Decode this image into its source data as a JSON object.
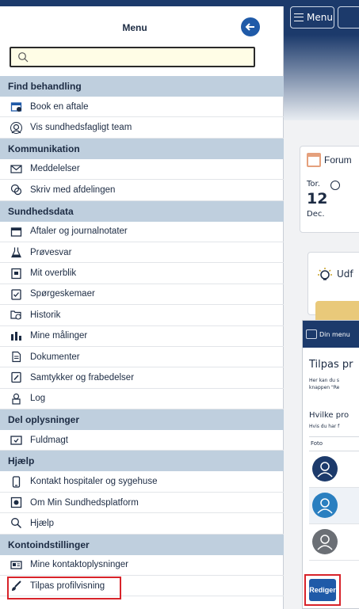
{
  "background_app": {
    "menu_button_label": "Menu",
    "card_title": "Forum",
    "date_day": "Tor.",
    "date_num": "12",
    "date_month": "Dec.",
    "card2_title": "Udf"
  },
  "popup": {
    "topbar_label": "Din menu",
    "title": "Tilpas pr",
    "desc_line1": "Her kan du s",
    "desc_line2": "knappen \"Re",
    "question": "Hvilke pro",
    "question_sub": "Hvis du har f",
    "table_header": "Foto",
    "edit_button": "Rediger"
  },
  "menu": {
    "title": "Menu",
    "search_placeholder": "",
    "sections": [
      {
        "header": "Find behandling",
        "items": [
          {
            "label": "Book en aftale",
            "icon": "calendar-add-icon"
          },
          {
            "label": "Vis sundhedsfagligt team",
            "icon": "team-icon"
          }
        ]
      },
      {
        "header": "Kommunikation",
        "items": [
          {
            "label": "Meddelelser",
            "icon": "envelope-icon"
          },
          {
            "label": "Skriv med afdelingen",
            "icon": "chat-icon"
          }
        ]
      },
      {
        "header": "Sundhedsdata",
        "items": [
          {
            "label": "Aftaler og journalnotater",
            "icon": "calendar-icon"
          },
          {
            "label": "Prøvesvar",
            "icon": "flask-icon"
          },
          {
            "label": "Mit overblik",
            "icon": "overview-icon"
          },
          {
            "label": "Spørgeskemaer",
            "icon": "clipboard-icon"
          },
          {
            "label": "Historik",
            "icon": "history-icon"
          },
          {
            "label": "Mine målinger",
            "icon": "measurement-icon"
          },
          {
            "label": "Dokumenter",
            "icon": "document-icon"
          },
          {
            "label": "Samtykker og frabedelser",
            "icon": "consent-icon"
          },
          {
            "label": "Log",
            "icon": "log-icon"
          }
        ]
      },
      {
        "header": "Del oplysninger",
        "items": [
          {
            "label": "Fuldmagt",
            "icon": "proxy-icon"
          }
        ]
      },
      {
        "header": "Hjælp",
        "items": [
          {
            "label": "Kontakt hospitaler og sygehuse",
            "icon": "phone-icon"
          },
          {
            "label": "Om Min Sundhedsplatform",
            "icon": "info-icon"
          },
          {
            "label": "Hjælp",
            "icon": "search-help-icon"
          }
        ]
      },
      {
        "header": "Kontoindstillinger",
        "items": [
          {
            "label": "Mine kontaktoplysninger",
            "icon": "contact-card-icon"
          },
          {
            "label": "Tilpas profilvisning",
            "icon": "paintbrush-icon"
          }
        ]
      }
    ]
  },
  "colors": {
    "nav_dark": "#1c3a6b",
    "section_header": "#bfcfde",
    "accent_blue": "#1f5aa8",
    "highlight_red": "#d8232a",
    "search_bg": "#fffde6"
  }
}
